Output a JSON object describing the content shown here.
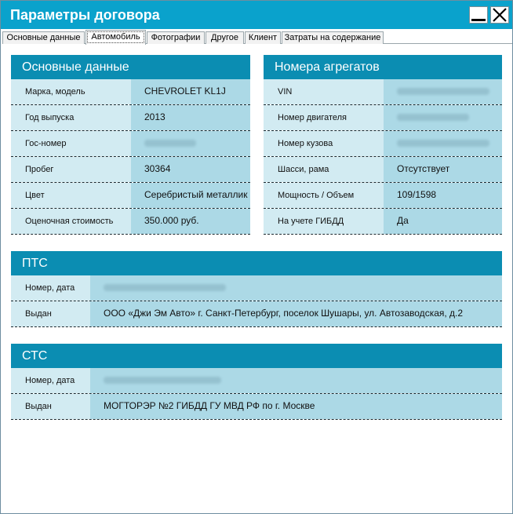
{
  "window": {
    "title": "Параметры договора"
  },
  "tabs": [
    {
      "label": "Основные данные"
    },
    {
      "label": "Автомобиль"
    },
    {
      "label": "Фотографии"
    },
    {
      "label": "Другое"
    },
    {
      "label": "Клиент"
    },
    {
      "label": "Затраты на содержание"
    }
  ],
  "basic": {
    "header": "Основные данные",
    "rows": [
      {
        "label": "Марка, модель",
        "value": "CHEVROLET  KL1J"
      },
      {
        "label": "Год выпуска",
        "value": "2013"
      },
      {
        "label": "Гос-номер",
        "value": ""
      },
      {
        "label": "Пробег",
        "value": "30364"
      },
      {
        "label": "Цвет",
        "value": "Серебристый металлик"
      },
      {
        "label": "Оценочная стоимость",
        "value": "350.000 руб."
      }
    ]
  },
  "units": {
    "header": "Номера агрегатов",
    "rows": [
      {
        "label": "VIN",
        "value": ""
      },
      {
        "label": "Номер двигателя",
        "value": ""
      },
      {
        "label": "Номер кузова",
        "value": ""
      },
      {
        "label": "Шасси, рама",
        "value": "Отсутствует"
      },
      {
        "label": "Мощность / Объем",
        "value": "109/1598"
      },
      {
        "label": "На учете ГИБДД",
        "value": "Да"
      }
    ]
  },
  "pts": {
    "header": "ПТС",
    "rows": [
      {
        "label": "Номер, дата",
        "value": ""
      },
      {
        "label": "Выдан",
        "value": "ООО «Джи Эм Авто» г. Санкт-Петербург, поселок Шушары, ул. Автозаводская, д.2"
      }
    ]
  },
  "sts": {
    "header": "СТС",
    "rows": [
      {
        "label": "Номер, дата",
        "value": ""
      },
      {
        "label": "Выдан",
        "value": "МОГТОРЭР №2 ГИБДД ГУ МВД РФ по г. Москве"
      }
    ]
  },
  "icons": {
    "minimize": "minimize-icon",
    "close": "close-icon"
  },
  "colors": {
    "titlebar": "#0aa2cc",
    "panel_header": "#0b8db2",
    "label_bg": "#d2ebf2",
    "value_bg": "#acd9e6"
  }
}
